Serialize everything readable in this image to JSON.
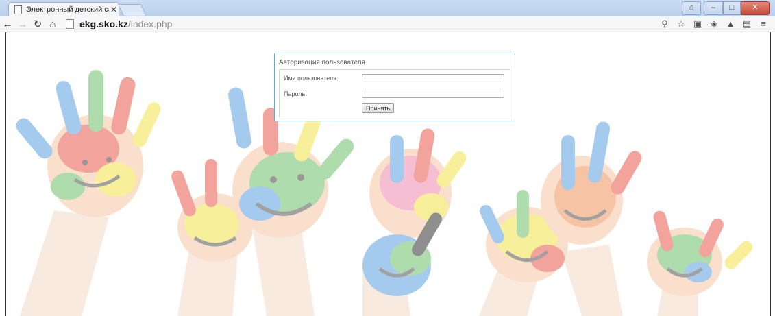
{
  "browser": {
    "tab_title": "Электронный детский са",
    "tab_close": "✕",
    "url_host": "ekg.sko.kz",
    "url_path": "/index.php"
  },
  "login": {
    "legend": "Авторизация пользователя",
    "username_label": "Имя пользователя:",
    "username_value": "",
    "password_label": "Пароль:",
    "password_value": "",
    "submit_label": "Принять"
  },
  "colors": {
    "accent_border": "#6aa6c7",
    "tab_strip": "#c9dcf3"
  },
  "icons": {
    "back": "arrow-left",
    "forward": "arrow-right",
    "reload": "reload",
    "home": "home",
    "page": "document",
    "zoom": "magnifier",
    "bookmark": "star",
    "menu": "hamburger"
  }
}
